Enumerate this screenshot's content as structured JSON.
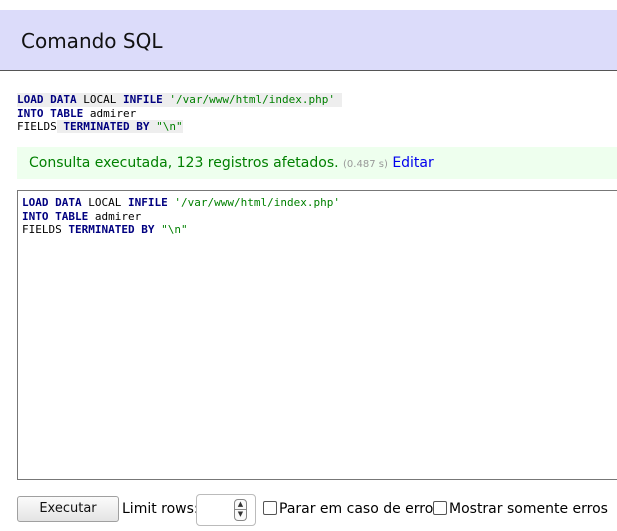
{
  "header": {
    "title": "Comando SQL"
  },
  "preview": {
    "line1": {
      "kw1": "LOAD",
      "kw2": "DATA",
      "plain1": "LOCAL",
      "kw3": "INFILE",
      "str1": "'/var/www/html/index.php'"
    },
    "line2": {
      "kw1": "INTO",
      "kw2": "TABLE",
      "plain1": "admirer"
    },
    "line3": {
      "plain1": "FIELDS",
      "kw1": "TERMINATED",
      "kw2": "BY",
      "str1": "\"\\n\""
    }
  },
  "message": {
    "text": "Consulta executada, 123 registros afetados.",
    "time": "(0.487 s)",
    "edit_link": "Editar"
  },
  "editor": {
    "line1": {
      "kw1": "LOAD",
      "kw2": "DATA",
      "plain1": "LOCAL",
      "kw3": "INFILE",
      "str1": "'/var/www/html/index.php'"
    },
    "line2": {
      "kw1": "INTO",
      "kw2": "TABLE",
      "plain1": "admirer"
    },
    "line3": {
      "plain1": "FIELDS",
      "kw1": "TERMINATED",
      "kw2": "BY",
      "str1": "\"\\n\""
    }
  },
  "controls": {
    "execute_label": "Executar",
    "limit_label": "Limit rows:",
    "limit_value": "",
    "stop_on_error_label": "Parar em caso de erro",
    "stop_on_error_checked": false,
    "only_errors_label": "Mostrar somente erros",
    "only_errors_checked": false
  },
  "colors": {
    "header_bg": "#dcdcfa",
    "message_bg": "#eeffee",
    "message_text": "#008000",
    "keyword": "#000080",
    "string": "#008000",
    "link": "#0000ee"
  },
  "icons": {
    "spinner_up": "chevron-up-icon",
    "spinner_down": "chevron-down-icon"
  }
}
